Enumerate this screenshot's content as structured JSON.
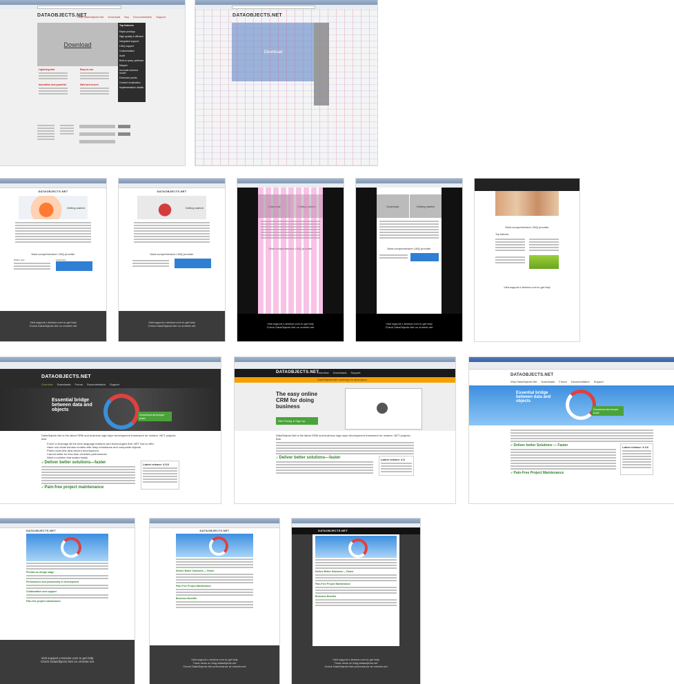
{
  "logo": "DATAOBJECTS.NET",
  "s1": {
    "nav": [
      "Why DataObjects.Net",
      "Download",
      "Buy",
      "Documentation",
      "Support"
    ],
    "hero_text": "Download",
    "sidebar_title": "Top features",
    "sidebar_items": [
      "Rapid prototyp",
      "High quality & efficient",
      "Integrated support",
      "LINQ support",
      "Customization",
      "Audit",
      "Built-in query optimizer",
      "Mapper",
      "Accurate schema model",
      "Extension points",
      "Content localization",
      "Implementation details"
    ],
    "features": [
      "Lightning fast",
      "Easy to use",
      "Innovative and powerful",
      "Safe and secure"
    ]
  },
  "s2": {
    "hero_text": "Download"
  },
  "s3": {
    "hero_text": "Getting started",
    "tagline": "Most comprehensive LINQ provider",
    "sections": [
      "What's new",
      "Customers"
    ],
    "footer_line1": "Visit support.x-tensive.com to get help",
    "footer_line2": "Check DataObjects.Net on ormeter.net"
  },
  "s4": {
    "hero_text": "Getting started",
    "tagline": "Most comprehensive LINQ provider",
    "footer_line1": "Visit support.x-tensive.com to get help",
    "footer_line2": "Check DataObjects.Net on ormeter.net"
  },
  "s5": {
    "hero_left": "Download",
    "hero_right": "Getting started",
    "tagline": "Most comprehensive LINQ provider",
    "footer_line1": "Visit support.x-tensive.com to get help",
    "footer_line2": "Check DataObjects.Net on ormeter.net"
  },
  "s6": {
    "hero_left": "Download",
    "hero_right": "Getting started",
    "tagline": "Most comprehensive LINQ provider",
    "footer_line1": "Visit support.x-tensive.com to get help",
    "footer_line2": "Check DataObjects.Net on ormeter.net"
  },
  "s7": {
    "tagline": "Most comprehensive LINQ provider",
    "sections": [
      "Top features"
    ],
    "footer_line1": "Visit support.x-tensive.com to get help"
  },
  "s8": {
    "nav": [
      "Overview",
      "Downloads",
      "Forum",
      "Documentation",
      "Support"
    ],
    "hero_title": "Essential bridge between data and objects",
    "hero_button": "Download developer build",
    "intro": "DataObjects.Net is the latest ORM and business logic layer development framework for modern .NET projects that:",
    "bullets": [
      "Force to leverage all the best language features and technologies that .NET has to offer",
      "Have non-trivial domain models with deep inheritance and composite objects",
      "Prefer code-first (test-driven) development",
      "Cannot settle for less than excellent performance",
      "Want a solution that scales easily"
    ],
    "heading1": "Deliver better solutions—faster",
    "heading2": "Pain-free project maintenance",
    "latest_release": "Latest release: 4.5.6"
  },
  "s9": {
    "banner": "DataObjects.Net roadmap for discussion",
    "nav": [
      "Overview",
      "Downloads",
      "Support"
    ],
    "hero_title": "The easy online CRM for doing business",
    "hero_button": "Site Pricing & Sign Up",
    "intro": "DataObjects.Net is the latest ORM and business logic layer development framework for modern .NET projects that:",
    "heading1": "Deliver better solutions—faster",
    "latest_release": "Latest release: 4.5"
  },
  "s10": {
    "nav": [
      "Why DataObjects.Net",
      "Downloads",
      "Forum",
      "Documentation",
      "Support"
    ],
    "hero_title": "Essential bridge between data and objects",
    "hero_button": "Download developer build",
    "heading1": "Deliver better Solutions — Faster",
    "heading2": "Pain-Free Project Maintenance",
    "latest_release": "Latest release: 4.3.6"
  },
  "s11": {
    "headings": [
      "Flexible as design stage",
      "Performance and productivity in development",
      "Collaboration and support",
      "Pain-free project maintenance"
    ],
    "footer_line1": "Visit support.x-tensive.com to get help",
    "footer_line2": "Check DataObjects.Net on ormeter.net"
  },
  "s12": {
    "headings": [
      "Deliver Better Solutions — Faster",
      "Pain-Free Project Maintenance",
      "Business Benefits"
    ],
    "footer_line1": "Visit support.x-tensive.com to get help",
    "footer_line2": "Track news on blog.dataobjects.net",
    "footer_line3": "Check DataObjects.Net performance at ormeter.net"
  },
  "s13": {
    "headings": [
      "Deliver Better Solutions — Faster",
      "Pain-Free Project Maintenance",
      "Business Benefits"
    ],
    "footer_line1": "Visit support.x-tensive.com to get help",
    "footer_line2": "Track news on blog.dataobjects.net",
    "footer_line3": "Check DataObjects.Net performance at ormeter.net"
  },
  "colors": {
    "accent_red": "#cc2222",
    "dark_footer": "#333333",
    "green": "#44aa33",
    "orange": "#f5a000",
    "blue_hero": "#5aa6e8"
  }
}
